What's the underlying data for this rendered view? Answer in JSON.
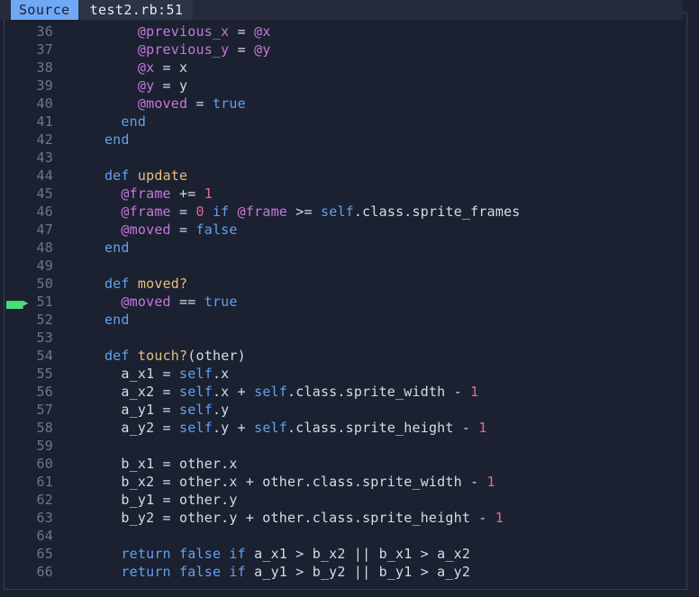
{
  "header": {
    "source_label": "Source",
    "file_location": "test2.rb:51"
  },
  "gutter": {
    "current_line_marker": "arrow-right-icon",
    "current_line_number": "51"
  },
  "colors": {
    "background": "#1b2130",
    "header_background": "#252b3a",
    "badge_background": "#6fa8f5",
    "file_badge_background": "#2c3344",
    "border": "#39404f",
    "linenumber": "#6b7691",
    "marker_green": "#4ade7b",
    "keyword_blue": "#61a0f0",
    "method_yellow": "#e8c07d",
    "ivar_purple": "#c678dd",
    "number_pink": "#e06c8a",
    "plain_text": "#d7dbe6"
  },
  "code_lines": [
    {
      "n": "36",
      "current": false,
      "tokens": [
        {
          "t": "        ",
          "c": "t-plain"
        },
        {
          "t": "@previous_x",
          "c": "t-ivar"
        },
        {
          "t": " = ",
          "c": "t-plain"
        },
        {
          "t": "@x",
          "c": "t-ivar"
        }
      ]
    },
    {
      "n": "37",
      "current": false,
      "tokens": [
        {
          "t": "        ",
          "c": "t-plain"
        },
        {
          "t": "@previous_y",
          "c": "t-ivar"
        },
        {
          "t": " = ",
          "c": "t-plain"
        },
        {
          "t": "@y",
          "c": "t-ivar"
        }
      ]
    },
    {
      "n": "38",
      "current": false,
      "tokens": [
        {
          "t": "        ",
          "c": "t-plain"
        },
        {
          "t": "@x",
          "c": "t-ivar"
        },
        {
          "t": " = x",
          "c": "t-plain"
        }
      ]
    },
    {
      "n": "39",
      "current": false,
      "tokens": [
        {
          "t": "        ",
          "c": "t-plain"
        },
        {
          "t": "@y",
          "c": "t-ivar"
        },
        {
          "t": " = y",
          "c": "t-plain"
        }
      ]
    },
    {
      "n": "40",
      "current": false,
      "tokens": [
        {
          "t": "        ",
          "c": "t-plain"
        },
        {
          "t": "@moved",
          "c": "t-ivar"
        },
        {
          "t": " = ",
          "c": "t-plain"
        },
        {
          "t": "true",
          "c": "t-kw"
        }
      ]
    },
    {
      "n": "41",
      "current": false,
      "tokens": [
        {
          "t": "      ",
          "c": "t-plain"
        },
        {
          "t": "end",
          "c": "t-kw"
        }
      ]
    },
    {
      "n": "42",
      "current": false,
      "tokens": [
        {
          "t": "    ",
          "c": "t-plain"
        },
        {
          "t": "end",
          "c": "t-kw"
        }
      ]
    },
    {
      "n": "43",
      "current": false,
      "tokens": []
    },
    {
      "n": "44",
      "current": false,
      "tokens": [
        {
          "t": "    ",
          "c": "t-plain"
        },
        {
          "t": "def",
          "c": "t-kw"
        },
        {
          "t": " ",
          "c": "t-plain"
        },
        {
          "t": "update",
          "c": "t-meth"
        }
      ]
    },
    {
      "n": "45",
      "current": false,
      "tokens": [
        {
          "t": "      ",
          "c": "t-plain"
        },
        {
          "t": "@frame",
          "c": "t-ivar"
        },
        {
          "t": " += ",
          "c": "t-plain"
        },
        {
          "t": "1",
          "c": "t-num"
        }
      ]
    },
    {
      "n": "46",
      "current": false,
      "tokens": [
        {
          "t": "      ",
          "c": "t-plain"
        },
        {
          "t": "@frame",
          "c": "t-ivar"
        },
        {
          "t": " = ",
          "c": "t-plain"
        },
        {
          "t": "0",
          "c": "t-num"
        },
        {
          "t": " ",
          "c": "t-plain"
        },
        {
          "t": "if",
          "c": "t-kw"
        },
        {
          "t": " ",
          "c": "t-plain"
        },
        {
          "t": "@frame",
          "c": "t-ivar"
        },
        {
          "t": " >= ",
          "c": "t-plain"
        },
        {
          "t": "self",
          "c": "t-kw"
        },
        {
          "t": ".class.sprite_frames",
          "c": "t-plain"
        }
      ]
    },
    {
      "n": "47",
      "current": false,
      "tokens": [
        {
          "t": "      ",
          "c": "t-plain"
        },
        {
          "t": "@moved",
          "c": "t-ivar"
        },
        {
          "t": " = ",
          "c": "t-plain"
        },
        {
          "t": "false",
          "c": "t-kw"
        }
      ]
    },
    {
      "n": "48",
      "current": false,
      "tokens": [
        {
          "t": "    ",
          "c": "t-plain"
        },
        {
          "t": "end",
          "c": "t-kw"
        }
      ]
    },
    {
      "n": "49",
      "current": false,
      "tokens": []
    },
    {
      "n": "50",
      "current": false,
      "tokens": [
        {
          "t": "    ",
          "c": "t-plain"
        },
        {
          "t": "def",
          "c": "t-kw"
        },
        {
          "t": " ",
          "c": "t-plain"
        },
        {
          "t": "moved?",
          "c": "t-meth"
        }
      ]
    },
    {
      "n": "51",
      "current": true,
      "tokens": [
        {
          "t": "      ",
          "c": "t-plain"
        },
        {
          "t": "@moved",
          "c": "t-ivar"
        },
        {
          "t": " == ",
          "c": "t-plain"
        },
        {
          "t": "true",
          "c": "t-kw"
        }
      ]
    },
    {
      "n": "52",
      "current": false,
      "tokens": [
        {
          "t": "    ",
          "c": "t-plain"
        },
        {
          "t": "end",
          "c": "t-kw"
        }
      ]
    },
    {
      "n": "53",
      "current": false,
      "tokens": []
    },
    {
      "n": "54",
      "current": false,
      "tokens": [
        {
          "t": "    ",
          "c": "t-plain"
        },
        {
          "t": "def",
          "c": "t-kw"
        },
        {
          "t": " ",
          "c": "t-plain"
        },
        {
          "t": "touch?",
          "c": "t-meth"
        },
        {
          "t": "(other)",
          "c": "t-plain"
        }
      ]
    },
    {
      "n": "55",
      "current": false,
      "tokens": [
        {
          "t": "      a_x1 = ",
          "c": "t-plain"
        },
        {
          "t": "self",
          "c": "t-kw"
        },
        {
          "t": ".x",
          "c": "t-plain"
        }
      ]
    },
    {
      "n": "56",
      "current": false,
      "tokens": [
        {
          "t": "      a_x2 = ",
          "c": "t-plain"
        },
        {
          "t": "self",
          "c": "t-kw"
        },
        {
          "t": ".x + ",
          "c": "t-plain"
        },
        {
          "t": "self",
          "c": "t-kw"
        },
        {
          "t": ".class.sprite_width - ",
          "c": "t-plain"
        },
        {
          "t": "1",
          "c": "t-num"
        }
      ]
    },
    {
      "n": "57",
      "current": false,
      "tokens": [
        {
          "t": "      a_y1 = ",
          "c": "t-plain"
        },
        {
          "t": "self",
          "c": "t-kw"
        },
        {
          "t": ".y",
          "c": "t-plain"
        }
      ]
    },
    {
      "n": "58",
      "current": false,
      "tokens": [
        {
          "t": "      a_y2 = ",
          "c": "t-plain"
        },
        {
          "t": "self",
          "c": "t-kw"
        },
        {
          "t": ".y + ",
          "c": "t-plain"
        },
        {
          "t": "self",
          "c": "t-kw"
        },
        {
          "t": ".class.sprite_height - ",
          "c": "t-plain"
        },
        {
          "t": "1",
          "c": "t-num"
        }
      ]
    },
    {
      "n": "59",
      "current": false,
      "tokens": []
    },
    {
      "n": "60",
      "current": false,
      "tokens": [
        {
          "t": "      b_x1 = other.x",
          "c": "t-plain"
        }
      ]
    },
    {
      "n": "61",
      "current": false,
      "tokens": [
        {
          "t": "      b_x2 = other.x + other.class.sprite_width - ",
          "c": "t-plain"
        },
        {
          "t": "1",
          "c": "t-num"
        }
      ]
    },
    {
      "n": "62",
      "current": false,
      "tokens": [
        {
          "t": "      b_y1 = other.y",
          "c": "t-plain"
        }
      ]
    },
    {
      "n": "63",
      "current": false,
      "tokens": [
        {
          "t": "      b_y2 = other.y + other.class.sprite_height - ",
          "c": "t-plain"
        },
        {
          "t": "1",
          "c": "t-num"
        }
      ]
    },
    {
      "n": "64",
      "current": false,
      "tokens": []
    },
    {
      "n": "65",
      "current": false,
      "tokens": [
        {
          "t": "      ",
          "c": "t-plain"
        },
        {
          "t": "return",
          "c": "t-kw"
        },
        {
          "t": " ",
          "c": "t-plain"
        },
        {
          "t": "false",
          "c": "t-kw"
        },
        {
          "t": " ",
          "c": "t-plain"
        },
        {
          "t": "if",
          "c": "t-kw"
        },
        {
          "t": " a_x1 > b_x2 || b_x1 > a_x2",
          "c": "t-plain"
        }
      ]
    },
    {
      "n": "66",
      "current": false,
      "tokens": [
        {
          "t": "      ",
          "c": "t-plain"
        },
        {
          "t": "return",
          "c": "t-kw"
        },
        {
          "t": " ",
          "c": "t-plain"
        },
        {
          "t": "false",
          "c": "t-kw"
        },
        {
          "t": " ",
          "c": "t-plain"
        },
        {
          "t": "if",
          "c": "t-kw"
        },
        {
          "t": " a_y1 > b_y2 || b_y1 > a_y2",
          "c": "t-plain"
        }
      ]
    }
  ]
}
